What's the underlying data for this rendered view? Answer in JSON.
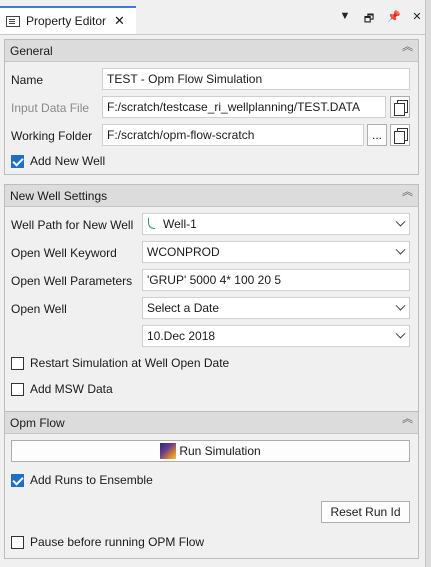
{
  "window": {
    "tab_title": "Property Editor",
    "close_glyph": "✕",
    "controls": [
      "▼",
      "🗗",
      "📌",
      "✕"
    ]
  },
  "general": {
    "header": "General",
    "name_label": "Name",
    "name_value": "TEST - Opm Flow Simulation",
    "input_label": "Input Data File",
    "input_value": "F:/scratch/testcase_ri_wellplanning/TEST.DATA",
    "workdir_label": "Working Folder",
    "workdir_value": "F:/scratch/opm-flow-scratch",
    "browse_label": "...",
    "add_new_well_label": "Add New Well",
    "add_new_well_checked": true
  },
  "new_well": {
    "header": "New Well Settings",
    "well_path_label": "Well Path for New Well",
    "well_path_value": "Well-1",
    "keyword_label": "Open Well Keyword",
    "keyword_value": "WCONPROD",
    "params_label": "Open Well Parameters",
    "params_value": "'GRUP' 5000 4* 100 20 5",
    "open_well_label": "Open Well",
    "open_well_value": "Select a Date",
    "date_value": "10.Dec 2018",
    "restart_label": "Restart Simulation at Well Open Date",
    "restart_checked": false,
    "msw_label": "Add MSW Data",
    "msw_checked": false
  },
  "opm_flow": {
    "header": "Opm Flow",
    "run_label": "Run Simulation",
    "add_runs_label": "Add Runs to Ensemble",
    "add_runs_checked": true,
    "reset_label": "Reset Run Id",
    "pause_label": "Pause before running OPM Flow",
    "pause_checked": false
  },
  "icons": {
    "collapse": "collapse-icon",
    "copy": "copy-icon",
    "well": "well-path-icon",
    "run": "opm-run-icon",
    "accent": "#1f6fc5"
  }
}
